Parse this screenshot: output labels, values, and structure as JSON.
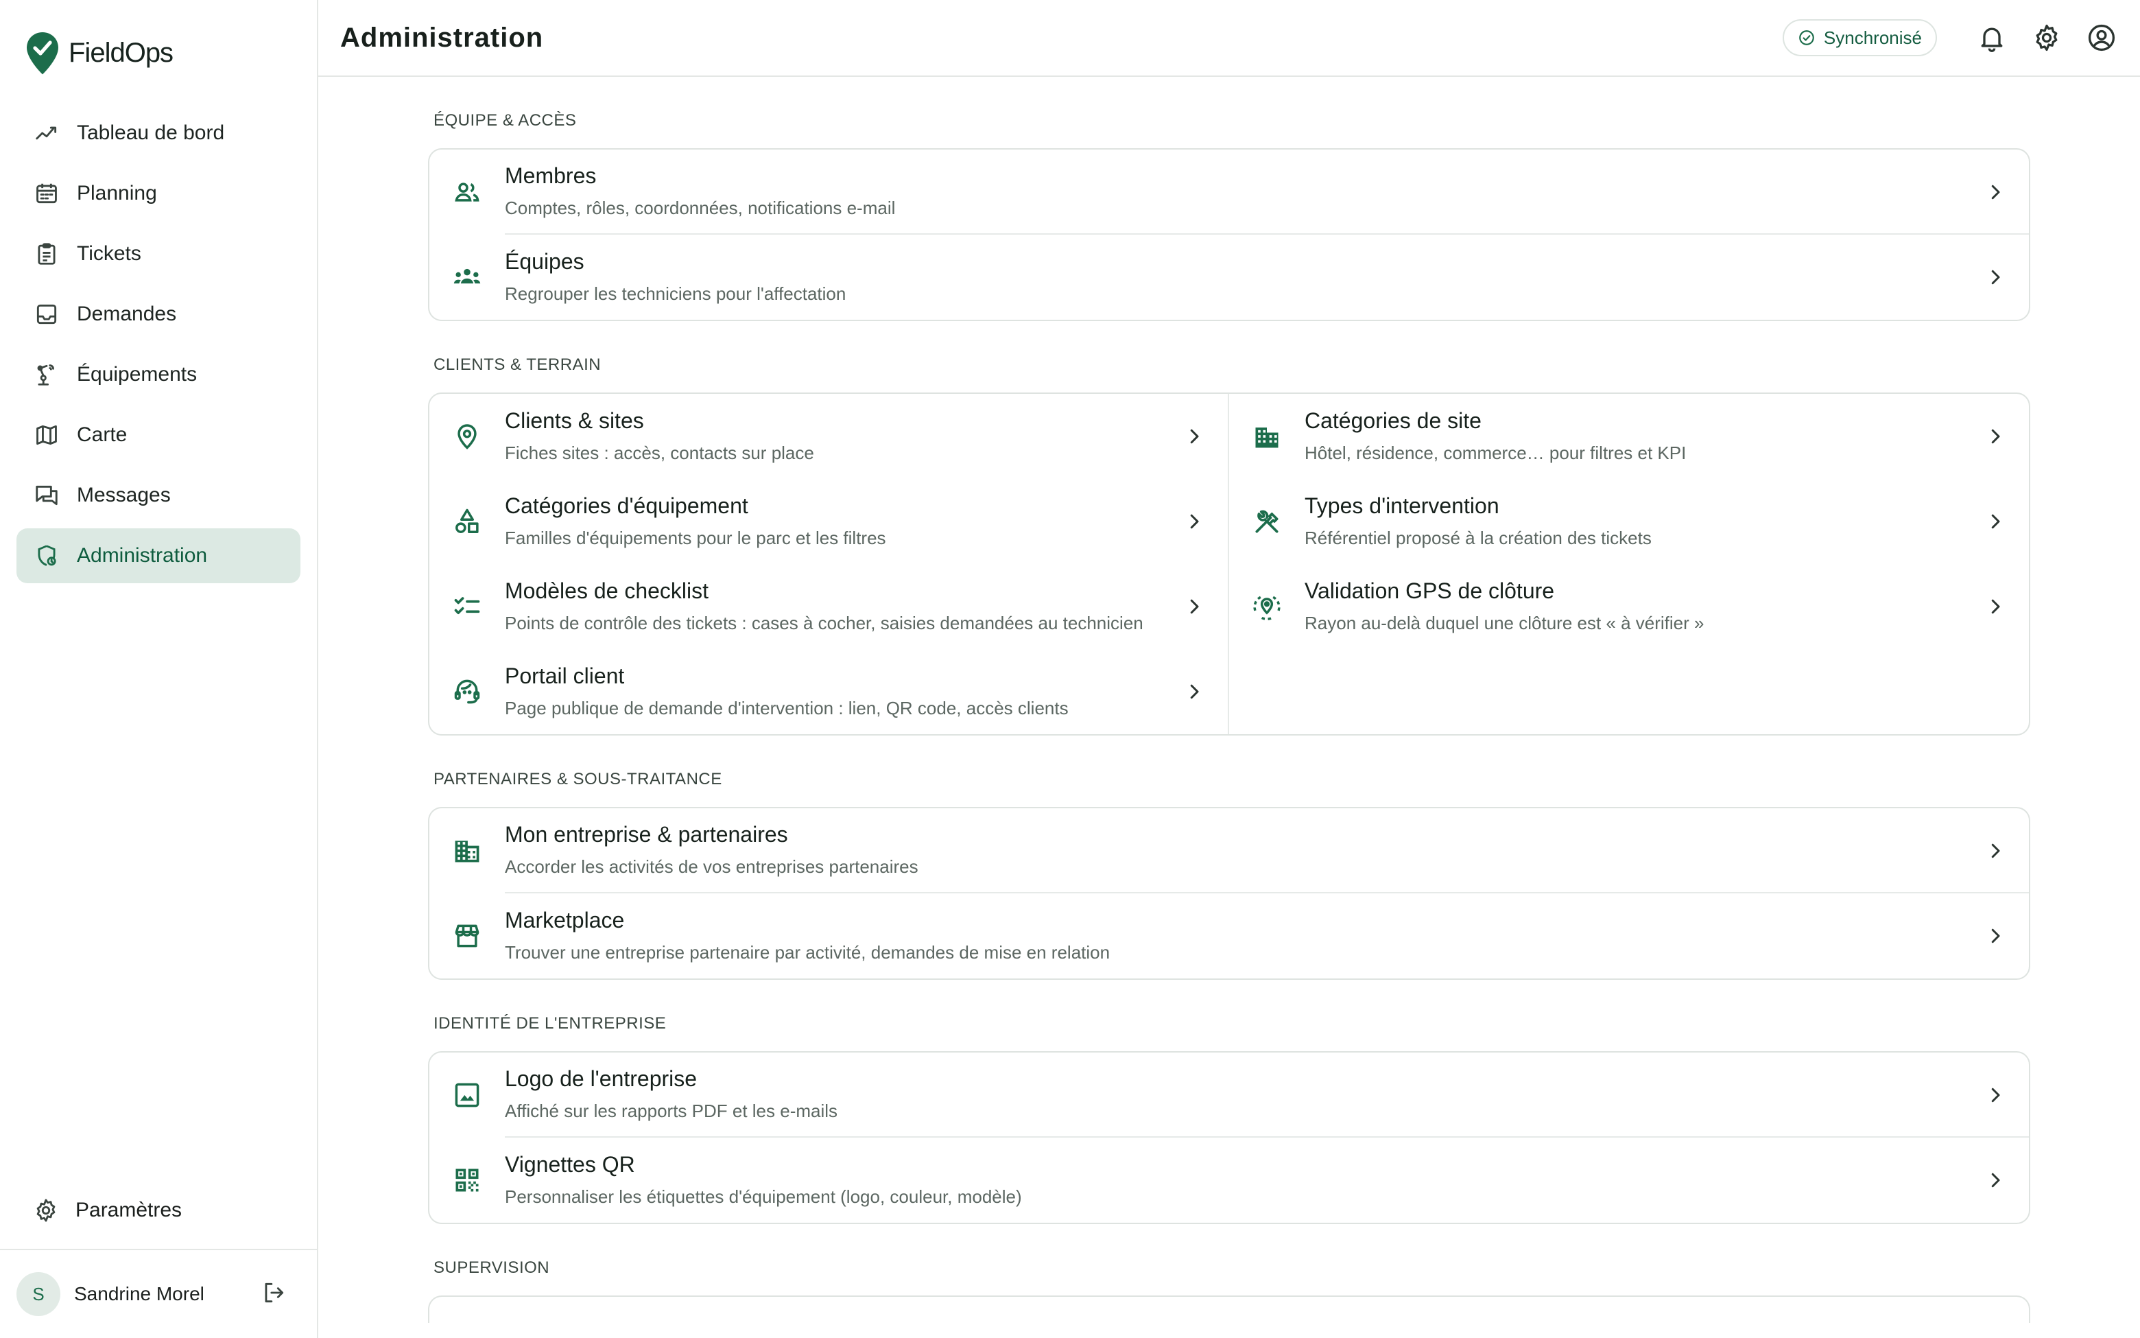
{
  "brand": {
    "name": "FieldOps"
  },
  "sidebar": {
    "items": [
      {
        "label": "Tableau de bord",
        "icon": "chart-line-icon"
      },
      {
        "label": "Planning",
        "icon": "calendar-icon"
      },
      {
        "label": "Tickets",
        "icon": "clipboard-icon"
      },
      {
        "label": "Demandes",
        "icon": "inbox-icon"
      },
      {
        "label": "Équipements",
        "icon": "robot-arm-icon"
      },
      {
        "label": "Carte",
        "icon": "map-icon"
      },
      {
        "label": "Messages",
        "icon": "messages-icon"
      },
      {
        "label": "Administration",
        "icon": "admin-icon",
        "active": true
      }
    ],
    "settings_label": "Paramètres",
    "user": {
      "initial": "S",
      "name": "Sandrine Morel"
    }
  },
  "header": {
    "title": "Administration",
    "sync_label": "Synchronisé"
  },
  "sections": {
    "team": {
      "title": "Équipe & accès",
      "rows": [
        {
          "title": "Membres",
          "subtitle": "Comptes, rôles, coordonnées, notifications e-mail"
        },
        {
          "title": "Équipes",
          "subtitle": "Regrouper les techniciens pour l'affectation"
        }
      ]
    },
    "clients": {
      "title": "Clients & terrain",
      "rows": [
        {
          "title": "Clients & sites",
          "subtitle": "Fiches sites : accès, contacts sur place"
        },
        {
          "title": "Catégories de site",
          "subtitle": "Hôtel, résidence, commerce… pour filtres et KPI"
        },
        {
          "title": "Catégories d'équipement",
          "subtitle": "Familles d'équipements pour le parc et les filtres"
        },
        {
          "title": "Types d'intervention",
          "subtitle": "Référentiel proposé à la création des tickets"
        },
        {
          "title": "Modèles de checklist",
          "subtitle": "Points de contrôle des tickets : cases à cocher, saisies demandées au technicien"
        },
        {
          "title": "Validation GPS de clôture",
          "subtitle": "Rayon au-delà duquel une clôture est « à vérifier »"
        },
        {
          "title": "Portail client",
          "subtitle": "Page publique de demande d'intervention : lien, QR code, accès clients"
        }
      ]
    },
    "partners": {
      "title": "Partenaires & sous-traitance",
      "rows": [
        {
          "title": "Mon entreprise & partenaires",
          "subtitle": "Accorder les activités de vos entreprises partenaires"
        },
        {
          "title": "Marketplace",
          "subtitle": "Trouver une entreprise partenaire par activité, demandes de mise en relation"
        }
      ]
    },
    "identity": {
      "title": "Identité de l'entreprise",
      "rows": [
        {
          "title": "Logo de l'entreprise",
          "subtitle": "Affiché sur les rapports PDF et les e-mails"
        },
        {
          "title": "Vignettes QR",
          "subtitle": "Personnaliser les étiquettes d'équipement (logo, couleur, modèle)"
        }
      ]
    },
    "supervision": {
      "title": "Supervision"
    }
  },
  "colors": {
    "accent": "#1c6d4b",
    "active_bg": "#dce9e3",
    "border": "#dee3e0"
  }
}
